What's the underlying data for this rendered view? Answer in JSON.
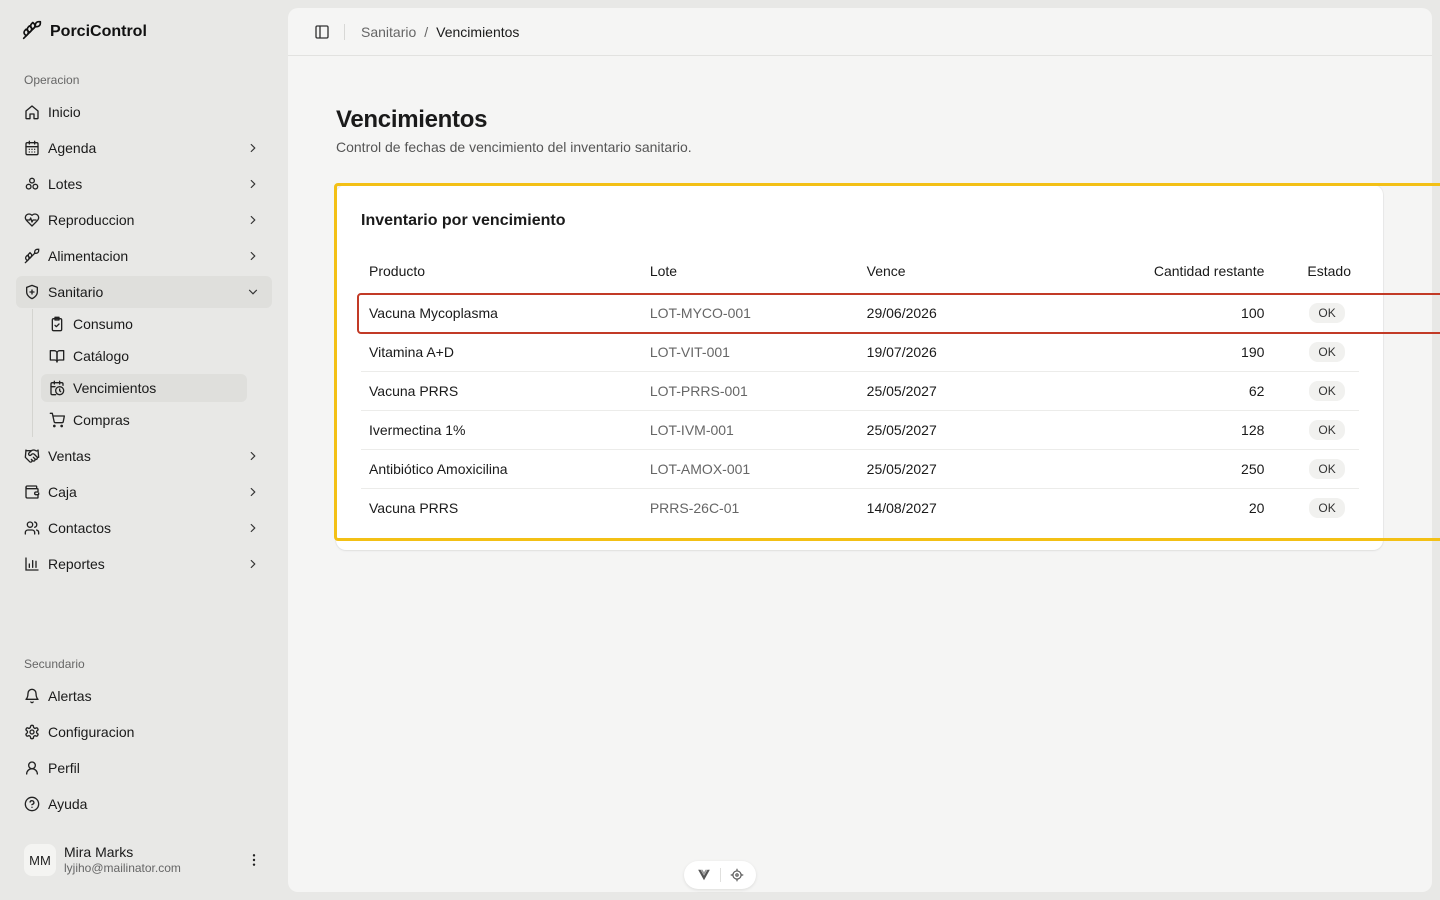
{
  "app": {
    "name": "PorciControl"
  },
  "sidebar": {
    "section_operacion": "Operacion",
    "section_secundario": "Secundario",
    "items": [
      {
        "label": "Inicio",
        "icon": "home-icon"
      },
      {
        "label": "Agenda",
        "icon": "calendar-icon"
      },
      {
        "label": "Lotes",
        "icon": "lots-icon"
      },
      {
        "label": "Reproduccion",
        "icon": "heart-pulse-icon"
      },
      {
        "label": "Alimentacion",
        "icon": "wheat-icon"
      },
      {
        "label": "Sanitario",
        "icon": "shield-plus-icon"
      },
      {
        "label": "Ventas",
        "icon": "handshake-icon"
      },
      {
        "label": "Caja",
        "icon": "wallet-icon"
      },
      {
        "label": "Contactos",
        "icon": "users-icon"
      },
      {
        "label": "Reportes",
        "icon": "bar-chart-icon"
      }
    ],
    "sanitario_sub": [
      {
        "label": "Consumo",
        "icon": "clipboard-check-icon"
      },
      {
        "label": "Catálogo",
        "icon": "book-open-icon"
      },
      {
        "label": "Vencimientos",
        "icon": "calendar-clock-icon"
      },
      {
        "label": "Compras",
        "icon": "cart-icon"
      }
    ],
    "secondary": [
      {
        "label": "Alertas",
        "icon": "bell-icon"
      },
      {
        "label": "Configuracion",
        "icon": "gear-icon"
      },
      {
        "label": "Perfil",
        "icon": "user-icon"
      },
      {
        "label": "Ayuda",
        "icon": "help-circle-icon"
      }
    ],
    "user": {
      "initials": "MM",
      "name": "Mira Marks",
      "email": "lyjiho@mailinator.com"
    }
  },
  "breadcrumb": {
    "parent": "Sanitario",
    "separator": "/",
    "current": "Vencimientos"
  },
  "page": {
    "title": "Vencimientos",
    "subtitle": "Control de fechas de vencimiento del inventario sanitario."
  },
  "card": {
    "title": "Inventario por vencimiento",
    "columns": [
      "Producto",
      "Lote",
      "Vence",
      "Cantidad restante",
      "Estado"
    ],
    "rows": [
      {
        "producto": "Vacuna Mycoplasma",
        "lote": "LOT-MYCO-001",
        "vence": "29/06/2026",
        "cantidad": "100",
        "estado": "OK"
      },
      {
        "producto": "Vitamina A+D",
        "lote": "LOT-VIT-001",
        "vence": "19/07/2026",
        "cantidad": "190",
        "estado": "OK"
      },
      {
        "producto": "Vacuna PRRS",
        "lote": "LOT-PRRS-001",
        "vence": "25/05/2027",
        "cantidad": "62",
        "estado": "OK"
      },
      {
        "producto": "Ivermectina 1%",
        "lote": "LOT-IVM-001",
        "vence": "25/05/2027",
        "cantidad": "128",
        "estado": "OK"
      },
      {
        "producto": "Antibiótico Amoxicilina",
        "lote": "LOT-AMOX-001",
        "vence": "25/05/2027",
        "cantidad": "250",
        "estado": "OK"
      },
      {
        "producto": "Vacuna PRRS",
        "lote": "PRRS-26C-01",
        "vence": "14/08/2027",
        "cantidad": "20",
        "estado": "OK"
      }
    ]
  },
  "colors": {
    "highlight_card": "#f3c015",
    "highlight_row": "#c23a26"
  }
}
